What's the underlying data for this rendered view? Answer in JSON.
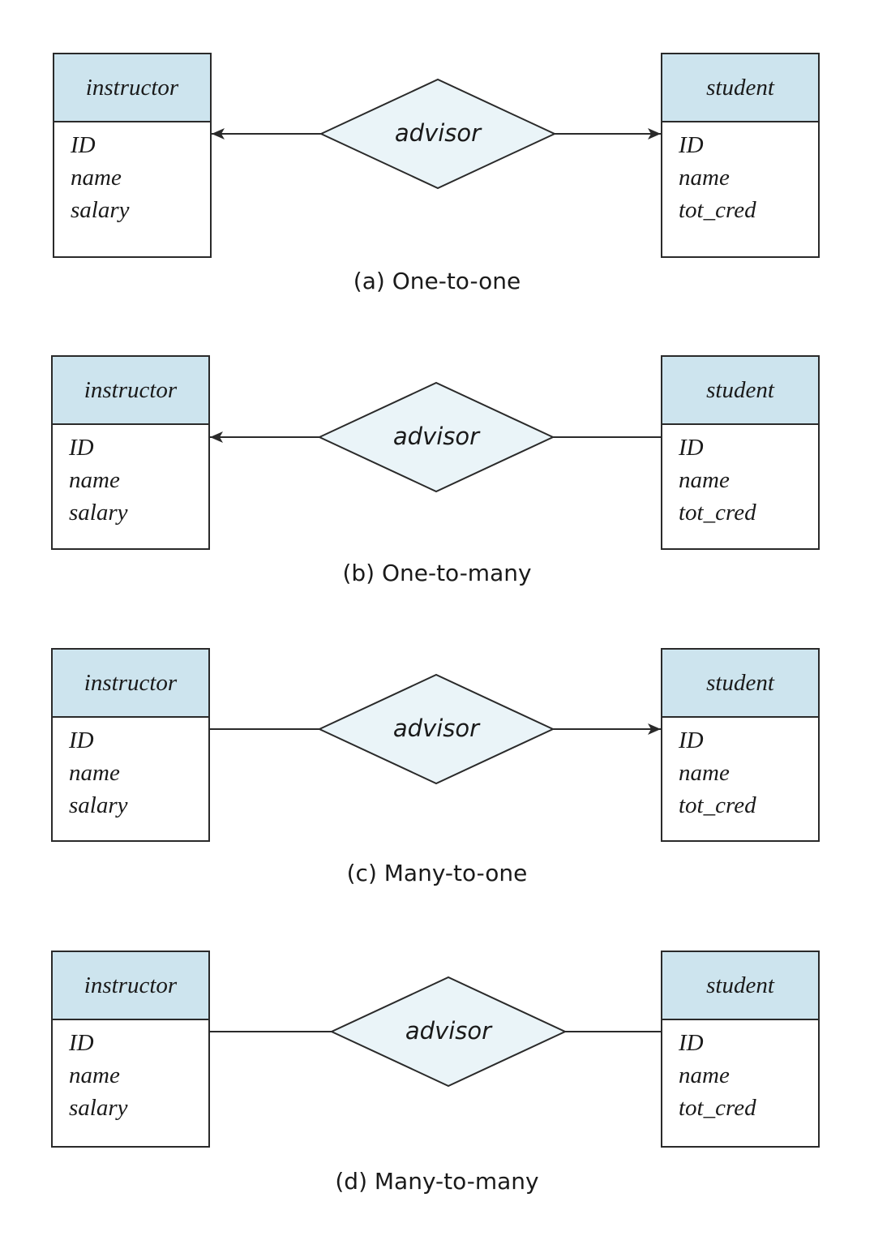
{
  "colors": {
    "entity_header": "#cde4ee",
    "relationship_fill": "#eaf4f8",
    "stroke": "#2a2a2a"
  },
  "panels": [
    {
      "caption": "(a) One-to-one",
      "left_entity": {
        "name": "instructor",
        "attributes": [
          "ID",
          "name",
          "salary"
        ]
      },
      "relationship": "advisor",
      "right_entity": {
        "name": "student",
        "attributes": [
          "ID",
          "name",
          "tot_cred"
        ]
      },
      "left_arrow": true,
      "right_arrow": true
    },
    {
      "caption": "(b) One-to-many",
      "left_entity": {
        "name": "instructor",
        "attributes": [
          "ID",
          "name",
          "salary"
        ]
      },
      "relationship": "advisor",
      "right_entity": {
        "name": "student",
        "attributes": [
          "ID",
          "name",
          "tot_cred"
        ]
      },
      "left_arrow": true,
      "right_arrow": false
    },
    {
      "caption": "(c) Many-to-one",
      "left_entity": {
        "name": "instructor",
        "attributes": [
          "ID",
          "name",
          "salary"
        ]
      },
      "relationship": "advisor",
      "right_entity": {
        "name": "student",
        "attributes": [
          "ID",
          "name",
          "tot_cred"
        ]
      },
      "left_arrow": false,
      "right_arrow": true
    },
    {
      "caption": "(d) Many-to-many",
      "left_entity": {
        "name": "instructor",
        "attributes": [
          "ID",
          "name",
          "salary"
        ]
      },
      "relationship": "advisor",
      "right_entity": {
        "name": "student",
        "attributes": [
          "ID",
          "name",
          "tot_cred"
        ]
      },
      "left_arrow": false,
      "right_arrow": false
    }
  ]
}
